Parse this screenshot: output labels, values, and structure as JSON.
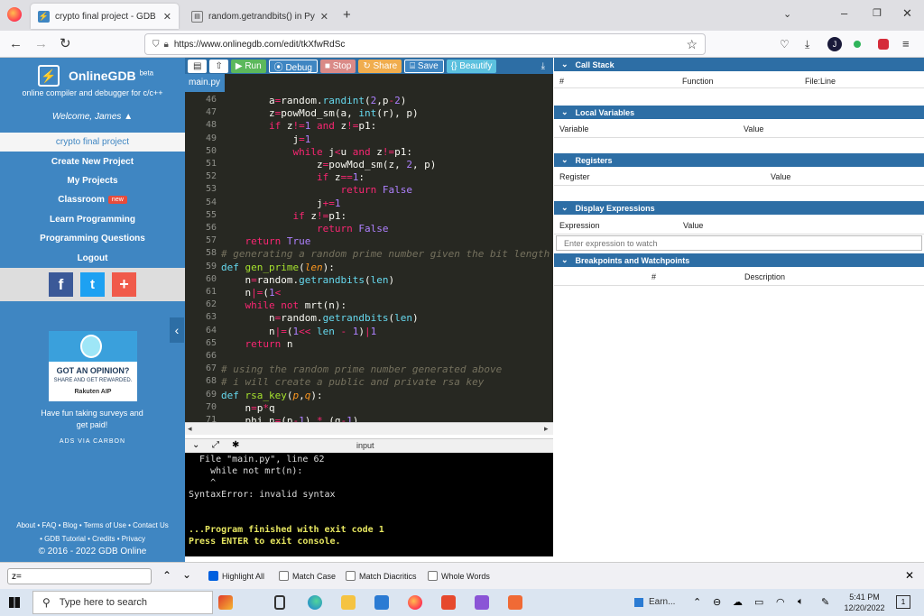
{
  "browser": {
    "tabs": [
      {
        "title": "crypto final project - GDB onlin…",
        "active": true
      },
      {
        "title": "random.getrandbits() in Python",
        "active": false
      }
    ],
    "new_tab": "+",
    "url": "https://www.onlinegdb.com/edit/tkXfwRdSc"
  },
  "sidebar": {
    "brand": "OnlineGDB",
    "brand_sup": "beta",
    "tagline": "online compiler and debugger for c/c++",
    "welcome": "Welcome, James",
    "items": [
      {
        "label": "crypto final project"
      },
      {
        "label": "Create New Project"
      },
      {
        "label": "My Projects"
      },
      {
        "label": "Classroom",
        "badge": "new"
      },
      {
        "label": "Learn Programming"
      },
      {
        "label": "Programming Questions"
      },
      {
        "label": "Logout"
      }
    ],
    "social": [
      "f",
      "t",
      "+"
    ],
    "ad": {
      "headline": "GOT AN OPINION?",
      "sub": "SHARE AND GET REWARDED.",
      "brand": "Rakuten AIP",
      "text": "Have fun taking surveys and get paid!",
      "via": "ADS VIA CARBON"
    },
    "footer": {
      "line1": "About • FAQ • Blog • Terms of Use • Contact Us",
      "line2": "• GDB Tutorial • Credits • Privacy",
      "line3": "© 2016 - 2022 GDB Online"
    }
  },
  "toolbar": {
    "run": "▶ Run",
    "debug": "⦿ Debug",
    "stop": "■ Stop",
    "share": "↻ Share",
    "save": "⌸ Save",
    "beautify": "{} Beautify"
  },
  "editor": {
    "file_tab": "main.py",
    "lines": [
      {
        "n": "46",
        "h": "        <span>a</span><span class='kw'>=</span>random.<span class='fn'>randint</span>(<span class='num'>2</span>,p<span class='kw'>-</span><span class='num'>2</span>)"
      },
      {
        "n": "47",
        "h": "        z<span class='kw'>=</span>powMod_sm(a, <span class='fn'>int</span>(r), p)"
      },
      {
        "n": "48",
        "h": "        <span class='kw'>if</span> z<span class='kw'>!=</span><span class='num'>1</span> <span class='kw'>and</span> z<span class='kw'>!=</span>p1:"
      },
      {
        "n": "49",
        "h": "            j<span class='kw'>=</span><span class='num'>1</span>"
      },
      {
        "n": "50",
        "h": "            <span class='kw'>while</span> j<span class='kw'>&lt;</span>u <span class='kw'>and</span> z<span class='kw'>!=</span>p1:"
      },
      {
        "n": "51",
        "h": "                z<span class='kw'>=</span>powMod_sm(z, <span class='num'>2</span>, p)"
      },
      {
        "n": "52",
        "h": "                <span class='kw'>if</span> z<span class='kw'>==</span><span class='num'>1</span>:"
      },
      {
        "n": "53",
        "h": "                    <span class='kw'>return</span> <span class='num'>False</span>"
      },
      {
        "n": "54",
        "h": "                j<span class='kw'>+=</span><span class='num'>1</span>"
      },
      {
        "n": "55",
        "h": "            <span class='kw'>if</span> z<span class='kw'>!=</span>p1:"
      },
      {
        "n": "56",
        "h": "                <span class='kw'>return</span> <span class='num'>False</span>"
      },
      {
        "n": "57",
        "h": "    <span class='kw'>return</span> <span class='num'>True</span>"
      },
      {
        "n": "58",
        "h": "<span class='cm'># generating a random prime number given the bit length</span>"
      },
      {
        "n": "59",
        "h": "<span class='fn'>def</span> <span class='def'>gen_prime</span>(<span class='arg'>len</span>):"
      },
      {
        "n": "60",
        "h": "    n<span class='kw'>=</span>random.<span class='fn'>getrandbits</span>(<span class='fn'>len</span>)"
      },
      {
        "n": "61",
        "h": "    n<span class='kw'>|=</span>(<span class='num'>1</span><span class='kw'>&lt;</span>"
      },
      {
        "n": "62",
        "h": "    <span class='kw'>while not</span> mrt(n):"
      },
      {
        "n": "63",
        "h": "        n<span class='kw'>=</span>random.<span class='fn'>getrandbits</span>(<span class='fn'>len</span>)"
      },
      {
        "n": "64",
        "h": "        n<span class='kw'>|=</span>(<span class='num'>1</span><span class='kw'>&lt;&lt;</span> <span class='fn'>len</span> <span class='kw'>-</span> <span class='num'>1</span>)<span class='kw'>|</span><span class='num'>1</span>"
      },
      {
        "n": "65",
        "h": "    <span class='kw'>return</span> n"
      },
      {
        "n": "66",
        "h": ""
      },
      {
        "n": "67",
        "h": "<span class='cm'># using the random prime number generated above</span>"
      },
      {
        "n": "68",
        "h": "<span class='cm'># i will create a public and private rsa key</span>"
      },
      {
        "n": "69",
        "h": "<span class='fn'>def</span> <span class='def'>rsa_key</span>(<span class='arg'>p</span>,<span class='arg'>q</span>):"
      },
      {
        "n": "70",
        "h": "    n<span class='kw'>=</span>p<span class='kw'>*</span>q"
      },
      {
        "n": "71",
        "h": "    phi_n<span class='kw'>=</span>(p<span class='kw'>-</span><span class='num'>1</span>) <span class='kw'>*</span> (q<span class='kw'>-</span><span class='num'>1</span>)"
      }
    ]
  },
  "console": {
    "label": "input",
    "lines": [
      {
        "t": "  File \"main.py\", line 62",
        "c": "#ddd"
      },
      {
        "t": "    while not mrt(n):",
        "c": "#ddd"
      },
      {
        "t": "    ^",
        "c": "#ddd"
      },
      {
        "t": "SyntaxError: invalid syntax",
        "c": "#ddd"
      },
      {
        "t": "",
        "c": "#ddd"
      },
      {
        "t": "",
        "c": "#ddd"
      },
      {
        "t": "...Program finished with exit code 1",
        "c": "#e6e660"
      },
      {
        "t": "Press ENTER to exit console.",
        "c": "#e6e660"
      }
    ]
  },
  "panels": {
    "call_stack": {
      "title": "Call Stack",
      "cols": [
        "#",
        "Function",
        "File:Line"
      ]
    },
    "locals": {
      "title": "Local Variables",
      "cols": [
        "Variable",
        "Value"
      ]
    },
    "registers": {
      "title": "Registers",
      "cols": [
        "Register",
        "Value"
      ]
    },
    "display": {
      "title": "Display Expressions",
      "cols": [
        "Expression",
        "Value"
      ],
      "placeholder": "Enter expression to watch"
    },
    "breakpoints": {
      "title": "Breakpoints and Watchpoints",
      "cols": [
        "#",
        "Description"
      ]
    }
  },
  "findbar": {
    "value": "z=",
    "options": [
      {
        "label": "Highlight All",
        "checked": true
      },
      {
        "label": "Match Case",
        "checked": false
      },
      {
        "label": "Match Diacritics",
        "checked": false
      },
      {
        "label": "Whole Words",
        "checked": false
      }
    ]
  },
  "taskbar": {
    "search_placeholder": "Type here to search",
    "weather": "Earn...",
    "time": "5:41 PM",
    "date": "12/20/2022",
    "notifications": "1"
  },
  "colors": {
    "gdb_blue": "#3f86c2",
    "toolbar": "#2d6ea5",
    "run": "#5cb85c",
    "debug": "#3f86c2",
    "stop": "#d9534f",
    "share": "#f0ad4e",
    "save": "#3f86c2",
    "beautify": "#5bc0de"
  }
}
